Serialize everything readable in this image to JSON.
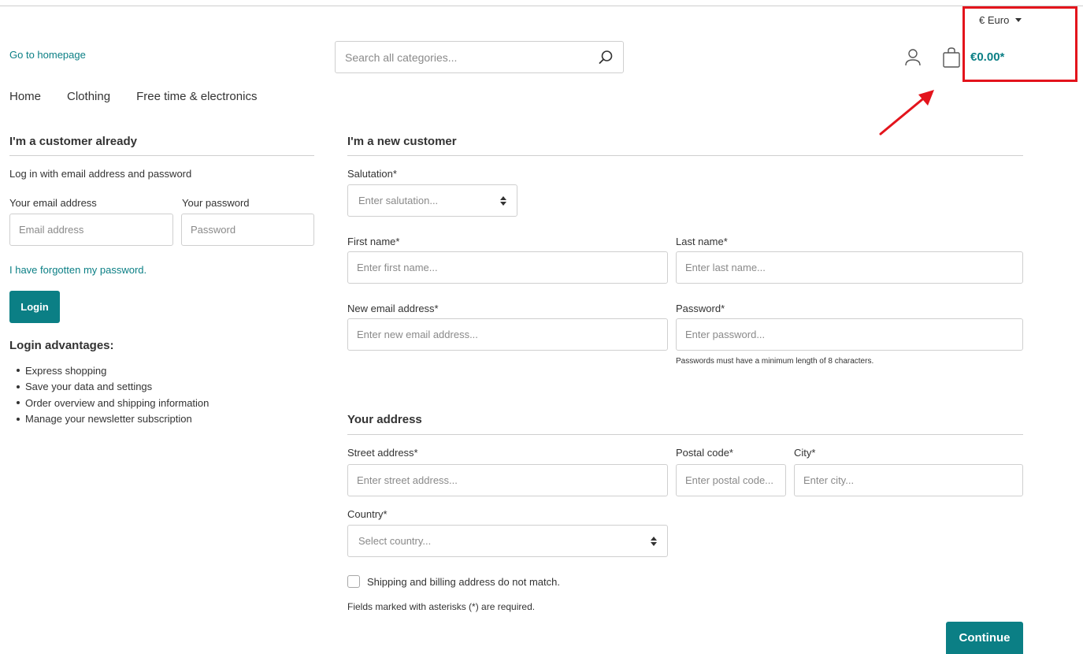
{
  "header": {
    "currency_label": "€ Euro",
    "home_link": "Go to homepage",
    "search_placeholder": "Search all categories...",
    "cart_total": "€0.00*"
  },
  "nav": {
    "items": [
      "Home",
      "Clothing",
      "Free time & electronics"
    ]
  },
  "login": {
    "title": "I'm a customer already",
    "intro": "Log in with email address and password",
    "email_label": "Your email address",
    "email_placeholder": "Email address",
    "password_label": "Your password",
    "password_placeholder": "Password",
    "forgot_link": "I have forgotten my password.",
    "login_button": "Login",
    "advantages_title": "Login advantages:",
    "advantages": [
      "Express shopping",
      "Save your data and settings",
      "Order overview and shipping information",
      "Manage your newsletter subscription"
    ]
  },
  "register": {
    "title": "I'm a new customer",
    "salutation_label": "Salutation*",
    "salutation_placeholder": "Enter salutation...",
    "first_name_label": "First name*",
    "first_name_placeholder": "Enter first name...",
    "last_name_label": "Last name*",
    "last_name_placeholder": "Enter last name...",
    "email_label": "New email address*",
    "email_placeholder": "Enter new email address...",
    "password_label": "Password*",
    "password_placeholder": "Enter password...",
    "password_hint": "Passwords must have a minimum length of 8 characters."
  },
  "address": {
    "title": "Your address",
    "street_label": "Street address*",
    "street_placeholder": "Enter street address...",
    "postal_label": "Postal code*",
    "postal_placeholder": "Enter postal code...",
    "city_label": "City*",
    "city_placeholder": "Enter city...",
    "country_label": "Country*",
    "country_placeholder": "Select country...",
    "different_billing_label": "Shipping and billing address do not match.",
    "required_note": "Fields marked with asterisks (*) are required.",
    "continue_button": "Continue"
  },
  "colors": {
    "accent": "#0b7f85",
    "annotation": "#e3141c"
  }
}
